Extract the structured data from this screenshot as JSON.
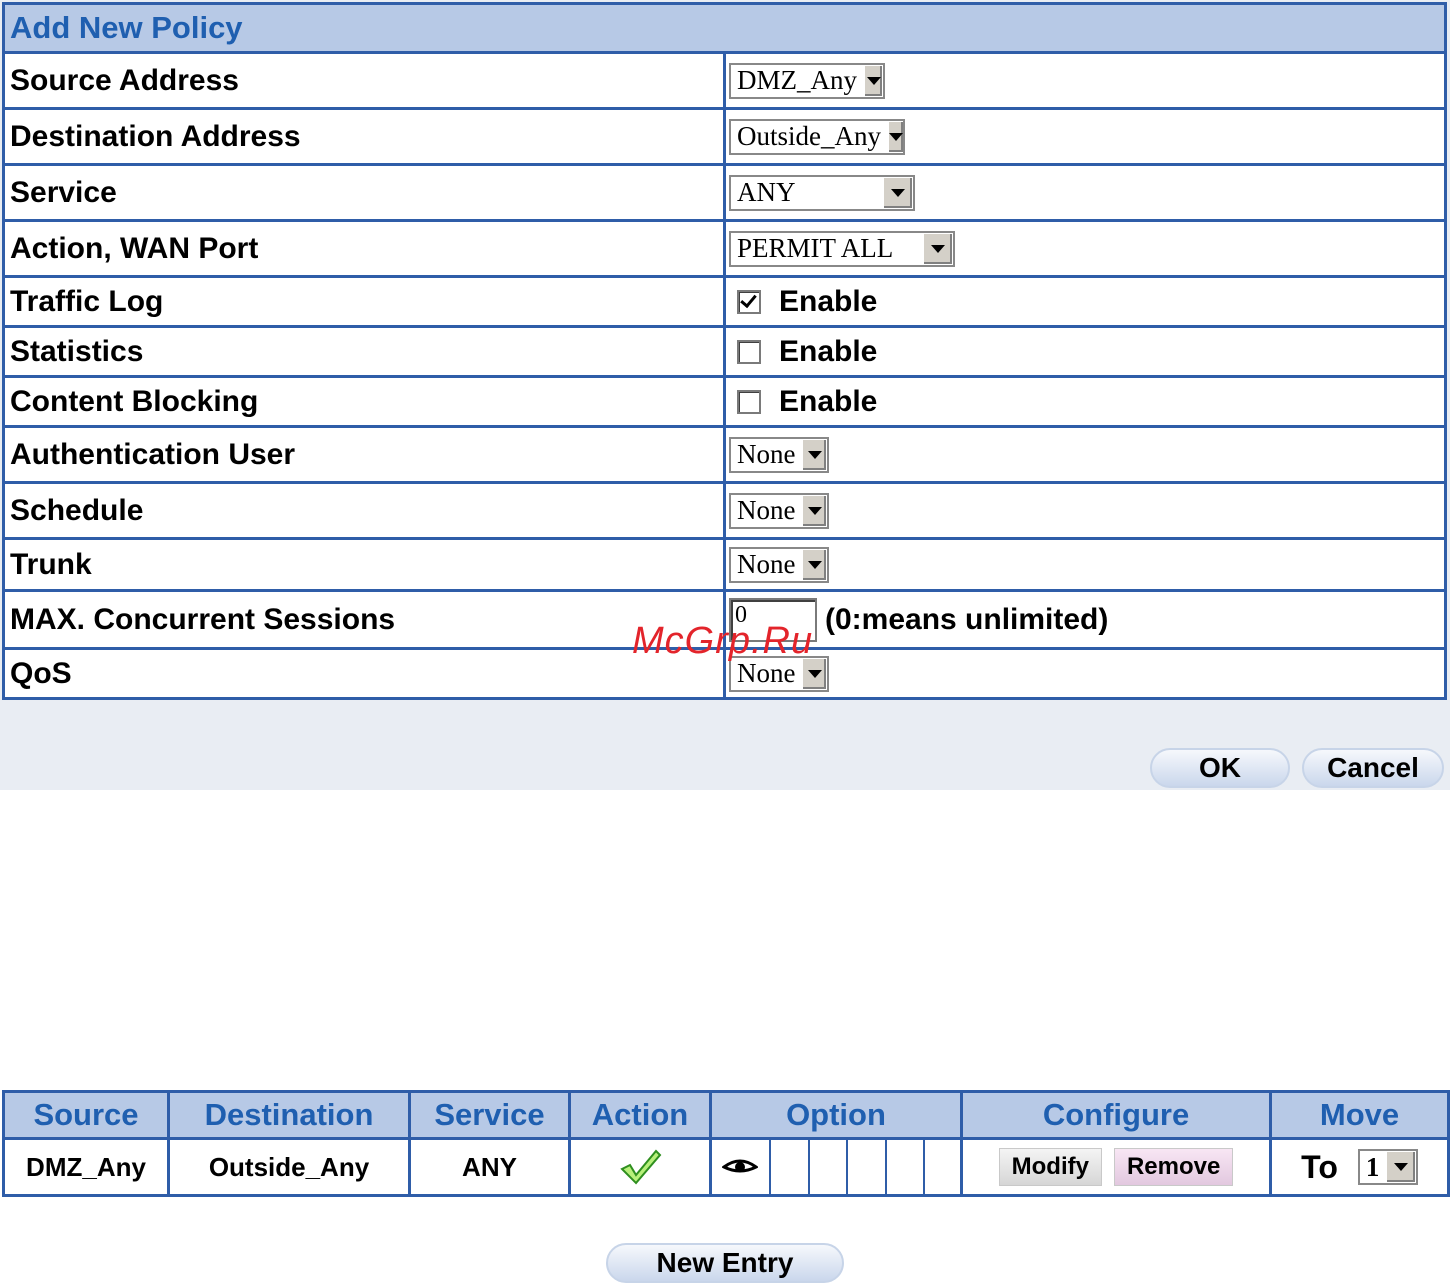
{
  "form": {
    "title": "Add New Policy",
    "rows": {
      "source_address": {
        "label": "Source Address",
        "value": "DMZ_Any"
      },
      "destination_address": {
        "label": "Destination Address",
        "value": "Outside_Any"
      },
      "service": {
        "label": "Service",
        "value": "ANY"
      },
      "action": {
        "label": "Action, WAN Port",
        "value": "PERMIT ALL"
      },
      "traffic_log": {
        "label": "Traffic Log",
        "checked": true,
        "text": "Enable"
      },
      "statistics": {
        "label": "Statistics",
        "checked": false,
        "text": "Enable"
      },
      "content_blocking": {
        "label": "Content Blocking",
        "checked": false,
        "text": "Enable"
      },
      "auth_user": {
        "label": "Authentication User",
        "value": "None"
      },
      "schedule": {
        "label": "Schedule",
        "value": "None"
      },
      "trunk": {
        "label": "Trunk",
        "value": "None"
      },
      "max_sessions": {
        "label": "MAX. Concurrent Sessions",
        "value": "0",
        "hint": "(0:means unlimited)"
      },
      "qos": {
        "label": "QoS",
        "value": "None"
      }
    },
    "ok_label": "OK",
    "cancel_label": "Cancel"
  },
  "watermark": "McGrp.Ru",
  "rules": {
    "headers": [
      "Source",
      "Destination",
      "Service",
      "Action",
      "Option",
      "Configure",
      "Move"
    ],
    "row": {
      "source": "DMZ_Any",
      "destination": "Outside_Any",
      "service": "ANY",
      "action_icon": "check-icon",
      "option_icon": "eye-icon",
      "modify_label": "Modify",
      "remove_label": "Remove",
      "move_to_label": "To",
      "move_to_value": "1"
    },
    "new_entry_label": "New Entry"
  },
  "colors": {
    "header_bg": "#b7c9e6",
    "header_text": "#1f5fb0",
    "border": "#2f5da8",
    "panel_bg": "#e9edf3"
  }
}
